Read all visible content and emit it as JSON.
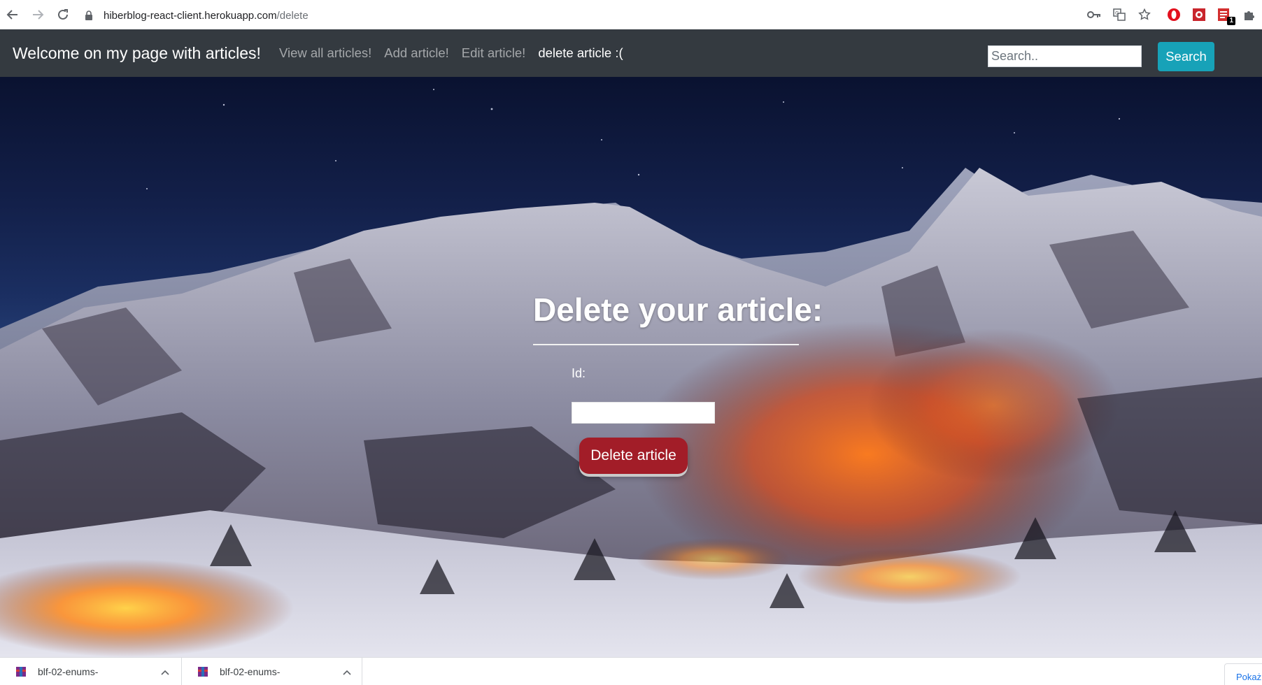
{
  "browser": {
    "url_host": "hiberblog-react-client.herokuapp.com",
    "url_path": "/delete",
    "extension_badge": "1",
    "icons": [
      "back-arrow-icon",
      "forward-arrow-icon",
      "reload-icon",
      "lock-icon",
      "key-icon",
      "translate-icon",
      "star-icon",
      "opera-icon",
      "extension-icon",
      "pdf-extension-icon",
      "puzzle-icon"
    ]
  },
  "navbar": {
    "brand": "Welcome on my page with articles!",
    "links": [
      "View all articles!",
      "Add article!",
      "Edit article!",
      "delete article :("
    ],
    "search_placeholder": "Search..",
    "search_button": "Search",
    "bg_color": "#343a40",
    "search_button_color": "#17a2b8"
  },
  "form": {
    "title": "Delete your article:",
    "id_label": "Id:",
    "id_value": "",
    "submit_label": "Delete article",
    "submit_color": "#a21d28"
  },
  "downloads": {
    "items": [
      {
        "name": "blf-02-enums-"
      },
      {
        "name": "blf-02-enums-"
      }
    ],
    "show_all": "Pokaż"
  }
}
